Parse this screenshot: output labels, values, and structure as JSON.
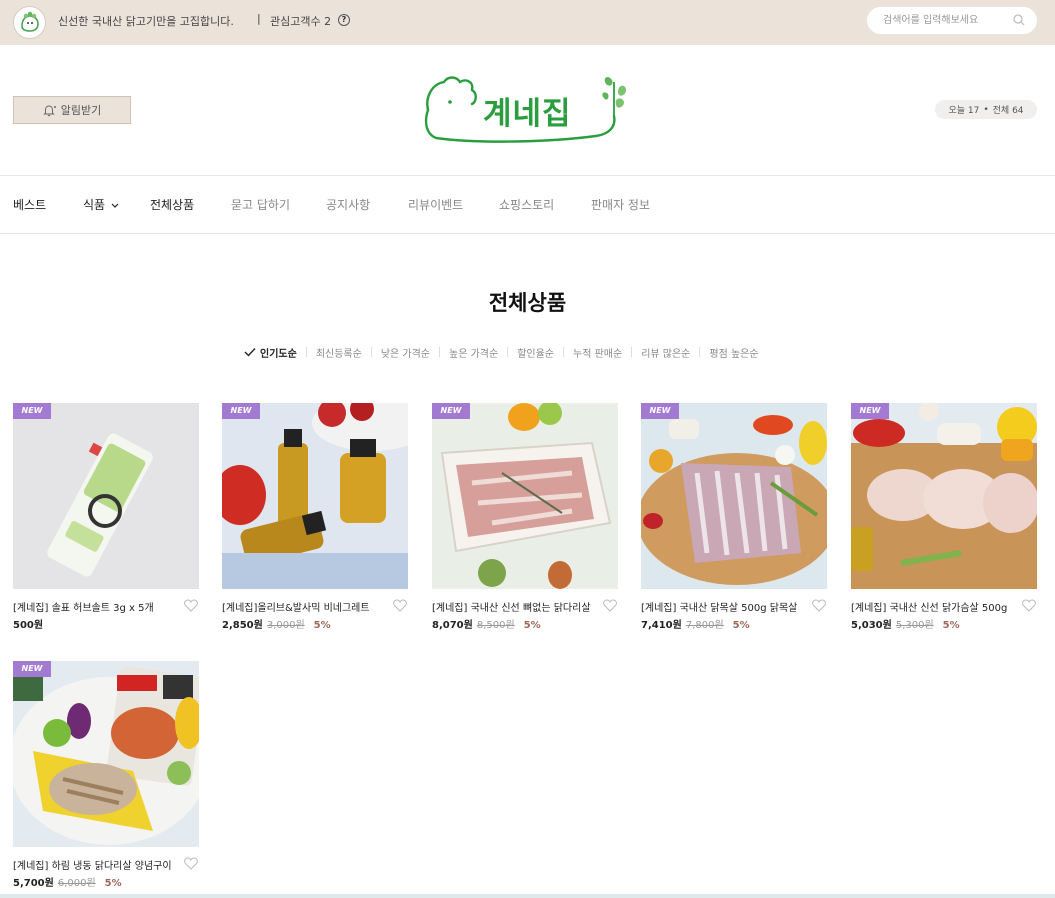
{
  "topbar": {
    "tagline": "신선한 국내산 닭고기만을 고집합니다.",
    "separator": "|",
    "favorite_label": "관심고객수 2",
    "help_icon": "question-icon",
    "search_placeholder": "검색어를 입력해보세요"
  },
  "header": {
    "notify_label": "알림받기",
    "brand_name": "계네집",
    "visitor_today": "오늘 17",
    "visitor_dot": "•",
    "visitor_total": "전체 64"
  },
  "nav": {
    "items": [
      "베스트",
      "식품",
      "전체상품",
      "묻고 답하기",
      "공지사항",
      "리뷰이벤트",
      "쇼핑스토리",
      "판매자 정보"
    ]
  },
  "main": {
    "title": "전체상품",
    "sort_options": [
      "인기도순",
      "최신등록순",
      "낮은 가격순",
      "높은 가격순",
      "할인율순",
      "누적 판매순",
      "리뷰 많은순",
      "평점 높은순"
    ],
    "active_sort": "인기도순"
  },
  "products": [
    {
      "badge": "NEW",
      "name": "[계네집] 솔표 허브솔트 3g x 5개",
      "price": "500원",
      "original": "",
      "discount": ""
    },
    {
      "badge": "NEW",
      "name": "[계네집]올리브&발사믹 비네그레트",
      "price": "2,850원",
      "original": "3,000원",
      "discount": "5%"
    },
    {
      "badge": "NEW",
      "name": "[계네집] 국내산 신선 뼈없는 닭다리살",
      "price": "8,070원",
      "original": "8,500원",
      "discount": "5%"
    },
    {
      "badge": "NEW",
      "name": "[계네집] 국내산 닭목살 500g 닭목살",
      "price": "7,410원",
      "original": "7,800원",
      "discount": "5%"
    },
    {
      "badge": "NEW",
      "name": "[계네집] 국내산 신선 닭가슴살 500g",
      "price": "5,030원",
      "original": "5,300원",
      "discount": "5%"
    },
    {
      "badge": "NEW",
      "name": "[계네집] 하림 냉동 닭다리살 양념구이",
      "price": "5,700원",
      "original": "6,000원",
      "discount": "5%"
    }
  ],
  "colors": {
    "topbar_bg": "#ebe2d9",
    "brand_green": "#2a9d3e",
    "badge_purple": "#a37ad1",
    "discount_color": "#a1675a"
  }
}
